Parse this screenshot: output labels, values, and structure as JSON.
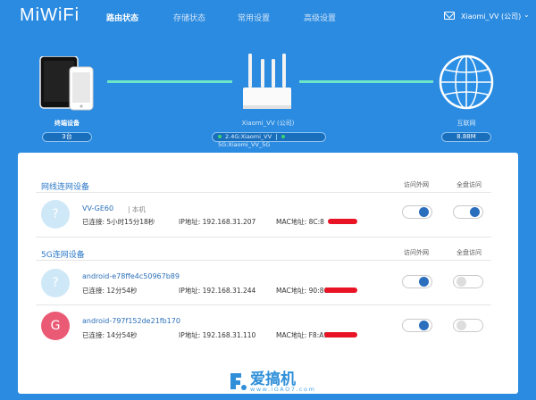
{
  "app": {
    "logo": "MiWiFi"
  },
  "nav": [
    "路由状态",
    "存储状态",
    "常用设置",
    "高级设置"
  ],
  "header": {
    "user": "Xiaomi_VV (公司)",
    "chevron": "⌄"
  },
  "topology": {
    "devices": {
      "label": "终端设备",
      "count": "3台"
    },
    "router": {
      "label": "Xiaomi_VV (公司)",
      "wifi_24": "2.4G:Xiaomi_VV",
      "wifi_5": "5G:Xiaomi_VV_5G"
    },
    "internet": {
      "label": "互联网",
      "speed": "8.88M"
    }
  },
  "wired": {
    "title": "网线连网设备",
    "col_wan": "访问外网",
    "col_all": "全盘访问",
    "device": {
      "name": "VV-GE60",
      "note": "| 本机",
      "connected": "已连接: 5小时15分18秒",
      "ip": "IP地址: 192.168.31.207",
      "mac": "MAC地址: 8C:8",
      "wan": true,
      "all": true,
      "avatar": "?"
    }
  },
  "g5": {
    "title": "5G连网设备",
    "col_wan": "访问外网",
    "col_all": "全盘访问",
    "devices": [
      {
        "name": "android-e78ffe4c50967b89",
        "connected": "已连接: 12分54秒",
        "ip": "IP地址: 192.168.31.244",
        "mac": "MAC地址: 90:86",
        "wan": true,
        "all": false,
        "avatar": "?"
      },
      {
        "name": "android-797f152de21fb170",
        "connected": "已连接: 14分54秒",
        "ip": "IP地址: 192.168.31.110",
        "mac": "MAC地址: F8:A9",
        "wan": true,
        "all": false,
        "avatar": "G"
      }
    ]
  },
  "watermark": {
    "cn": "爱搞机",
    "en": "www.iGAO7.com"
  }
}
